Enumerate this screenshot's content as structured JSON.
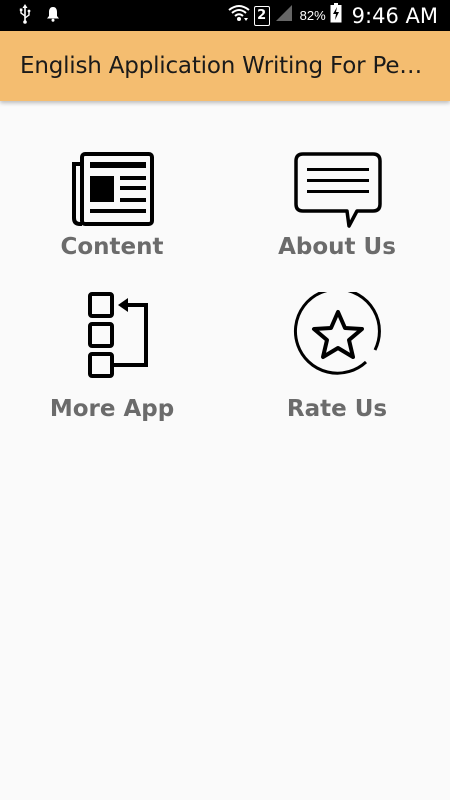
{
  "status_bar": {
    "sim_slot": "2",
    "battery_percent": "82%",
    "time": "9:46 AM",
    "icons": [
      "usb-icon",
      "notification-bell-icon",
      "wifi-icon",
      "signal-icon",
      "battery-charging-icon"
    ]
  },
  "app_bar": {
    "title": "English Application Writing For Pe…",
    "background_color": "#f4bd70"
  },
  "menu": {
    "content": {
      "label": "Content",
      "icon": "newspaper-icon"
    },
    "about_us": {
      "label": "About Us",
      "icon": "speech-bubble-icon"
    },
    "more_app": {
      "label": "More App",
      "icon": "app-list-icon"
    },
    "rate_us": {
      "label": "Rate Us",
      "icon": "star-circle-icon"
    }
  }
}
